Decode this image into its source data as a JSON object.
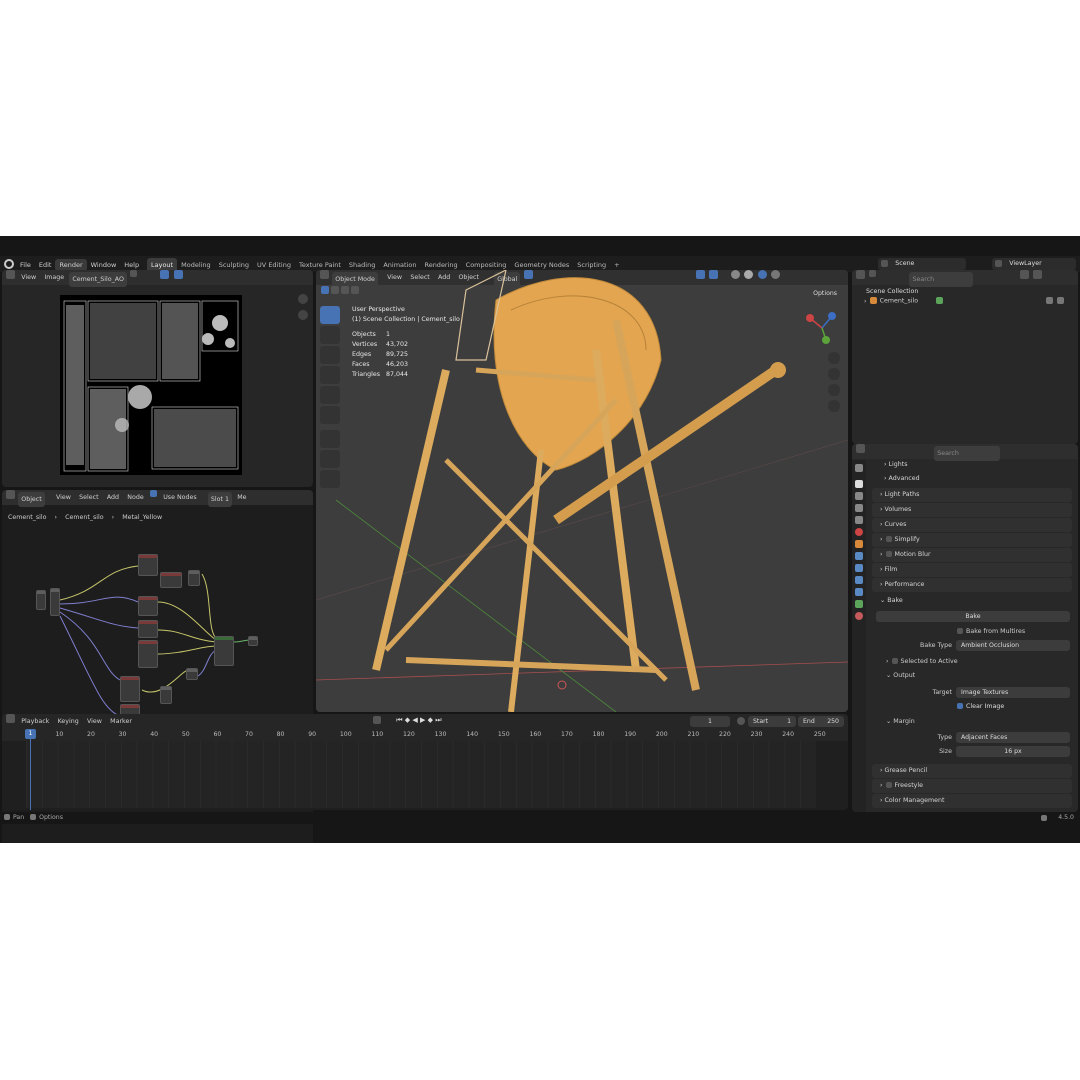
{
  "menu": [
    "File",
    "Edit",
    "Render",
    "Window",
    "Help"
  ],
  "workspaces": [
    "Layout",
    "Modeling",
    "Sculpting",
    "UV Editing",
    "Texture Paint",
    "Shading",
    "Animation",
    "Rendering",
    "Compositing",
    "Geometry Nodes",
    "Scripting",
    "+"
  ],
  "scene": {
    "label": "Scene",
    "view_layer": "ViewLayer"
  },
  "image_editor": {
    "view": "View",
    "image": "Image",
    "image_name": "Cement_Silo_AO"
  },
  "node_editor": {
    "mode": "Object",
    "menus": [
      "View",
      "Select",
      "Add",
      "Node"
    ],
    "use_nodes": "Use Nodes",
    "slot": "Slot 1",
    "me": "Me",
    "breadcrumb": [
      "Cement_silo",
      "Cement_silo",
      "Metal_Yellow"
    ]
  },
  "viewport": {
    "mode": "Object Mode",
    "menus": [
      "View",
      "Select",
      "Add",
      "Object"
    ],
    "orientation": "Global",
    "options": "Options",
    "perspective": "User Perspective",
    "collection": "(1) Scene Collection | Cement_silo",
    "stats": [
      {
        "label": "Objects",
        "value": "1"
      },
      {
        "label": "Vertices",
        "value": "43,702"
      },
      {
        "label": "Edges",
        "value": "89,725"
      },
      {
        "label": "Faces",
        "value": "46,203"
      },
      {
        "label": "Triangles",
        "value": "87,044"
      }
    ]
  },
  "outliner": {
    "search": "Search",
    "collection": "Scene Collection",
    "object": "Cement_silo"
  },
  "properties": {
    "search": "Search",
    "sections": [
      "Lights",
      "Advanced",
      "Light Paths",
      "Volumes",
      "Curves",
      "Simplify",
      "Motion Blur",
      "Film",
      "Performance",
      "Bake"
    ],
    "bake_button": "Bake",
    "bake_from_multires": "Bake from Multires",
    "bake_type_label": "Bake Type",
    "bake_type_value": "Ambient Occlusion",
    "selected_to_active": "Selected to Active",
    "output": "Output",
    "target_label": "Target",
    "target_value": "Image Textures",
    "clear_image": "Clear Image",
    "margin": "Margin",
    "type_label": "Type",
    "type_value": "Adjacent Faces",
    "size_label": "Size",
    "size_value": "16 px",
    "bottom_sections": [
      "Grease Pencil",
      "Freestyle",
      "Color Management"
    ]
  },
  "timeline": {
    "menus": [
      "Playback",
      "Keying",
      "View",
      "Marker"
    ],
    "current_frame": "1",
    "start_label": "Start",
    "start": "1",
    "end_label": "End",
    "end": "250",
    "ticks": [
      "1",
      "10",
      "20",
      "30",
      "40",
      "50",
      "60",
      "70",
      "80",
      "90",
      "100",
      "110",
      "120",
      "130",
      "140",
      "150",
      "160",
      "170",
      "180",
      "190",
      "200",
      "210",
      "220",
      "230",
      "240",
      "250"
    ]
  },
  "statusbar": {
    "pan": "Pan",
    "options": "Options",
    "version": "4.5.0"
  },
  "colors": {
    "accent": "#4772b3",
    "silo": "#d9a04a",
    "background": "#161616",
    "panel": "#282828"
  }
}
